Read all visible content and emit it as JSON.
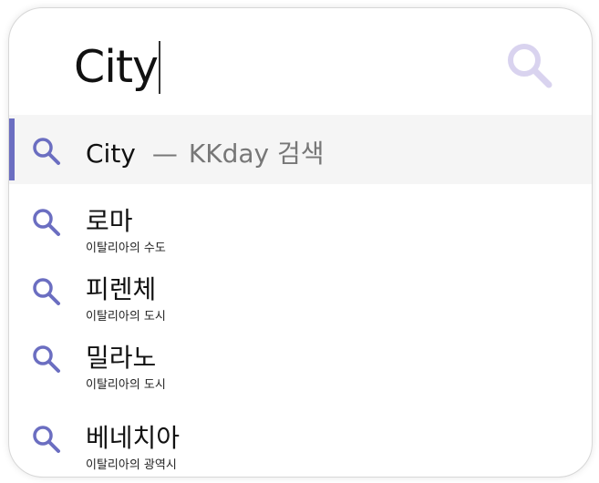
{
  "search": {
    "query": "City"
  },
  "suggestions": {
    "first": {
      "term": "City",
      "dash": "—",
      "action": "KKday 검색"
    },
    "items": [
      {
        "title": "로마",
        "subtitle": "이탈리아의 수도"
      },
      {
        "title": "피렌체",
        "subtitle": "이탈리아의 도시"
      },
      {
        "title": "밀라노",
        "subtitle": "이탈리아의 도시"
      },
      {
        "title": "베네치아",
        "subtitle": "이탈리아의 광역시"
      }
    ]
  },
  "icons": {
    "search_button": "search-icon",
    "suggestion": "search-icon"
  },
  "colors": {
    "accent": "#6b6ec1",
    "search_button": "#d9d3ef",
    "selected_row_bg": "#f5f5f5",
    "muted_text": "#777777"
  }
}
